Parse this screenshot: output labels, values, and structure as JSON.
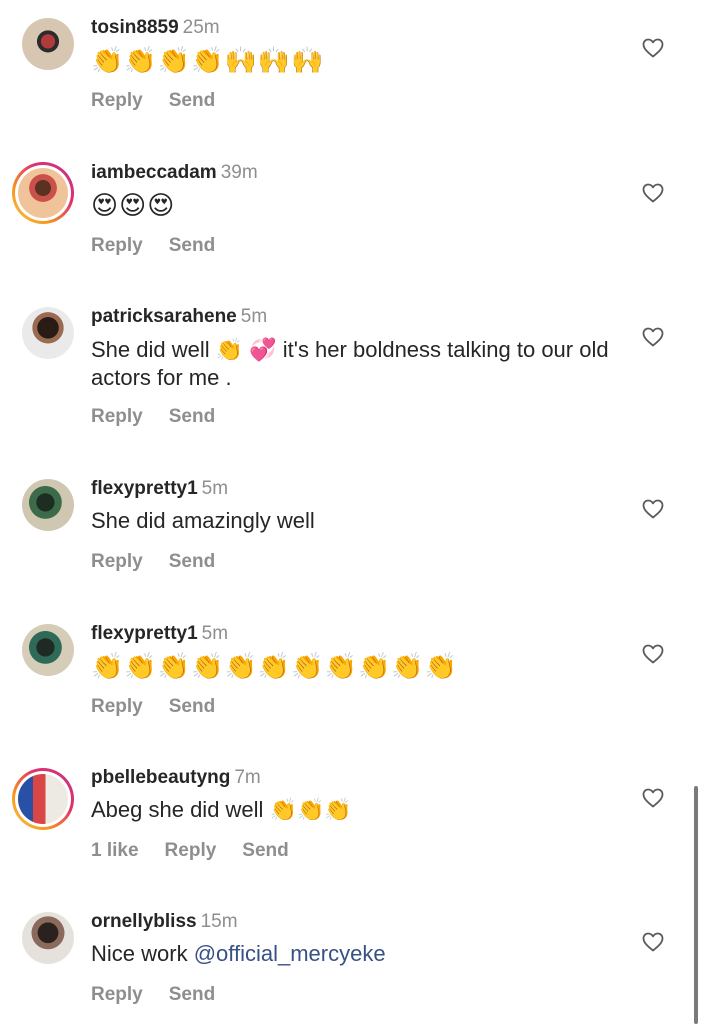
{
  "comments": [
    {
      "username": "tosin8859",
      "time": "25m",
      "text": "👏👏👏👏🙌🙌🙌",
      "actions": {
        "reply": "Reply",
        "send": "Send"
      },
      "avatar": "avatar-photo",
      "story_ring": false
    },
    {
      "username": "iambeccadam",
      "time": "39m",
      "text": "😍😍😍",
      "actions": {
        "reply": "Reply",
        "send": "Send"
      },
      "avatar": "avatar-photo",
      "story_ring": true
    },
    {
      "username": "patricksarahene",
      "time": "5m",
      "text": "She did well 👏 💞 it's her boldness talking to our old actors  for me .",
      "actions": {
        "reply": "Reply",
        "send": "Send"
      },
      "avatar": "avatar-photo",
      "story_ring": false
    },
    {
      "username": "flexypretty1",
      "time": "5m",
      "text": "She did amazingly well",
      "actions": {
        "reply": "Reply",
        "send": "Send"
      },
      "avatar": "avatar-photo",
      "story_ring": false
    },
    {
      "username": "flexypretty1",
      "time": "5m",
      "text": "👏👏👏👏👏👏👏👏👏👏👏",
      "actions": {
        "reply": "Reply",
        "send": "Send"
      },
      "avatar": "avatar-photo",
      "story_ring": false
    },
    {
      "username": "pbellebeautyng",
      "time": "7m",
      "text": "Abeg she did well 👏👏👏",
      "actions": {
        "likes": "1 like",
        "reply": "Reply",
        "send": "Send"
      },
      "avatar": "avatar-photo",
      "story_ring": true
    },
    {
      "username": "ornellybliss",
      "time": "15m",
      "text_prefix": "Nice work ",
      "mention": "@official_mercyeke",
      "actions": {
        "reply": "Reply",
        "send": "Send"
      },
      "avatar": "avatar-photo",
      "story_ring": false
    }
  ],
  "icons": {
    "like": "heart-outline-icon"
  },
  "colors": {
    "username": "#262626",
    "meta": "#8e8e8e",
    "mention": "#385185",
    "story_ring_start": "#f9c74f",
    "story_ring_end": "#c13584"
  }
}
